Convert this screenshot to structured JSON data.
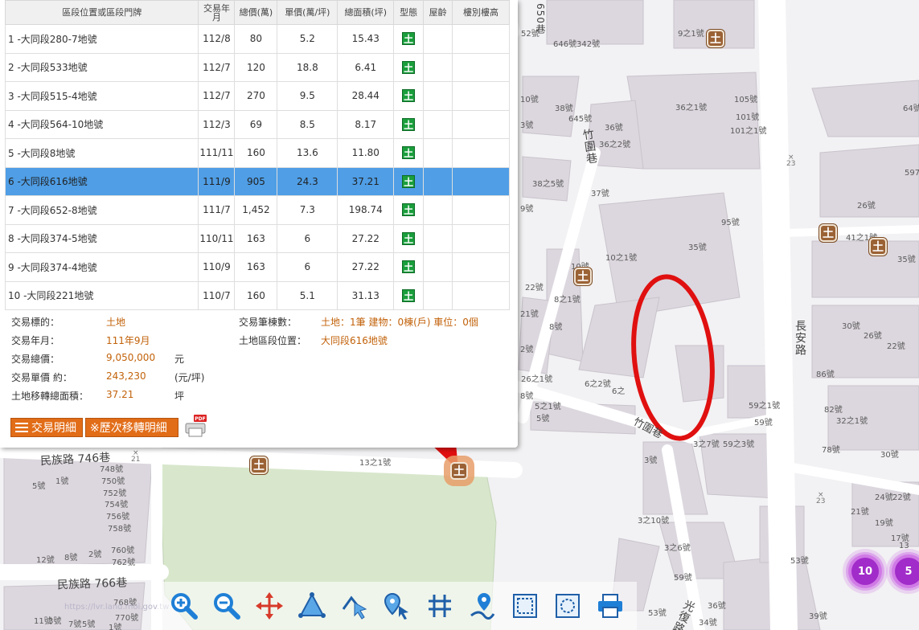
{
  "table": {
    "headers": {
      "address": "區段位置或區段門牌",
      "date": "交易年月",
      "total_price": "總價(萬)",
      "unit_price": "單價(萬/坪)",
      "area": "總面積(坪)",
      "type": "型態",
      "age": "屋齡",
      "floor": "樓別樓高"
    },
    "rows": [
      {
        "addr": "1 -大同段280-7地號",
        "date": "112/8",
        "total": "80",
        "unit": "5.2",
        "area": "15.43",
        "type": "土"
      },
      {
        "addr": "2 -大同段533地號",
        "date": "112/7",
        "total": "120",
        "unit": "18.8",
        "area": "6.41",
        "type": "土"
      },
      {
        "addr": "3 -大同段515-4地號",
        "date": "112/7",
        "total": "270",
        "unit": "9.5",
        "area": "28.44",
        "type": "土"
      },
      {
        "addr": "4 -大同段564-10地號",
        "date": "112/3",
        "total": "69",
        "unit": "8.5",
        "area": "8.17",
        "type": "土"
      },
      {
        "addr": "5 -大同段8地號",
        "date": "111/11",
        "total": "160",
        "unit": "13.6",
        "area": "11.80",
        "type": "土"
      },
      {
        "addr": "6 -大同段616地號",
        "date": "111/9",
        "total": "905",
        "unit": "24.3",
        "area": "37.21",
        "type": "土"
      },
      {
        "addr": "7 -大同段652-8地號",
        "date": "111/7",
        "total": "1,452",
        "unit": "7.3",
        "area": "198.74",
        "type": "土"
      },
      {
        "addr": "8 -大同段374-5地號",
        "date": "110/11",
        "total": "163",
        "unit": "6",
        "area": "27.22",
        "type": "土"
      },
      {
        "addr": "9 -大同段374-4地號",
        "date": "110/9",
        "total": "163",
        "unit": "6",
        "area": "27.22",
        "type": "土"
      },
      {
        "addr": "10 -大同段221地號",
        "date": "110/7",
        "total": "160",
        "unit": "5.1",
        "area": "31.13",
        "type": "土"
      }
    ]
  },
  "detail": {
    "target_k": "交易標的：",
    "target_v": "土地",
    "ym_k": "交易年月：",
    "ym_v": "111年9月",
    "total_k": "交易總價：",
    "total_v": "9,050,000",
    "total_u": "元",
    "unit_k": "交易單價 約：",
    "unit_v": "243,230",
    "unit_u": "(元/坪)",
    "area_k": "土地移轉總面積：",
    "area_v": "37.21",
    "area_u": "坪",
    "count_k": "交易筆棟數：",
    "count_v": "土地：1筆 建物：0棟(戶) 車位：0個",
    "loc_k": "土地區段位置：",
    "loc_v": "大同段616地號"
  },
  "buttons": {
    "detail": "交易明細",
    "history": "※歷次移轉明細",
    "pdf": "PDF"
  },
  "map": {
    "roads": {
      "changan": "長安路",
      "zhuwei": "竹圍巷",
      "zhuwei2": "竹圍巷",
      "minzu746": "民族路 746巷",
      "minzu766": "民族路 766巷",
      "guangfu": "光復路",
      "lane650": "650巷"
    },
    "markers": {
      "land": "土"
    },
    "clusters": {
      "c10": "10",
      "c5": "5"
    },
    "watermark": "https://lvr.land.moi.gov.tw"
  },
  "colors": {
    "selected_row": "#4f9ee6",
    "value_text": "#c2620a",
    "button": "#e26d18",
    "land_type": "#1a9e3c",
    "marker": "#9b6235",
    "annotation": "#e01010",
    "cluster": "#a12cc9"
  }
}
